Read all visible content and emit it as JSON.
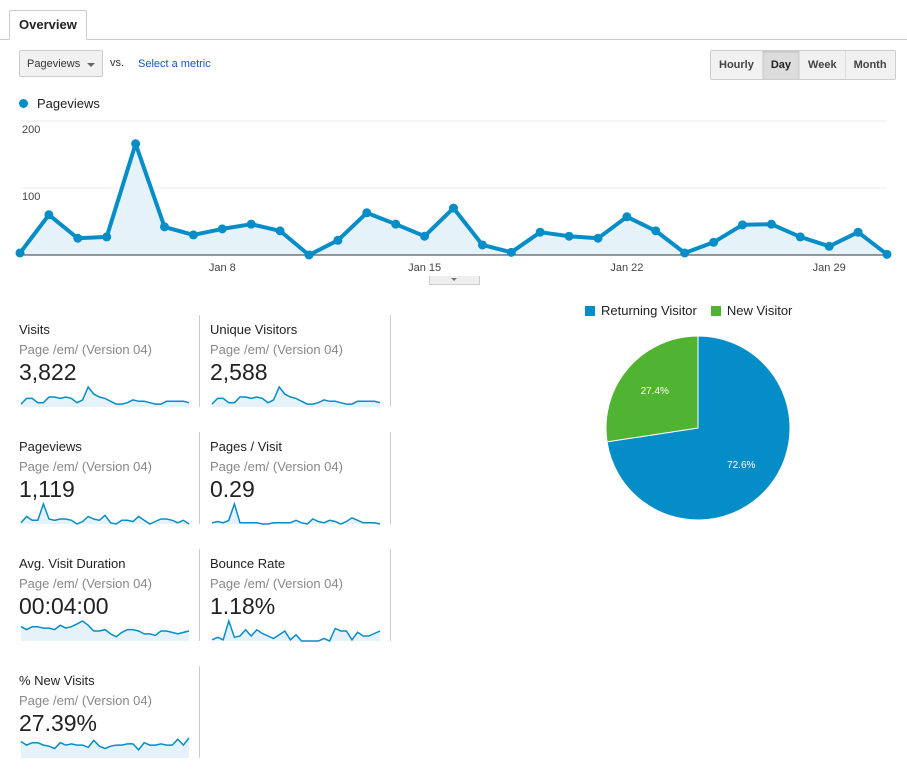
{
  "tabs": [
    {
      "label": "Overview",
      "active": true
    }
  ],
  "toolbar": {
    "metric_select": "Pageviews",
    "vs_label": "vs.",
    "select_metric_link": "Select a metric",
    "periods": [
      {
        "label": "Hourly",
        "active": false
      },
      {
        "label": "Day",
        "active": true
      },
      {
        "label": "Week",
        "active": false
      },
      {
        "label": "Month",
        "active": false
      }
    ]
  },
  "colors": {
    "primary": "#058dc7",
    "secondary": "#50b432",
    "area_fill": "#e6f2fa"
  },
  "chart_data": [
    {
      "type": "area",
      "title": "",
      "legend": [
        "Pageviews"
      ],
      "series": [
        {
          "name": "Pageviews",
          "values": [
            3,
            60,
            25,
            27,
            166,
            42,
            30,
            39,
            46,
            36,
            0,
            22,
            63,
            46,
            28,
            70,
            15,
            4,
            34,
            28,
            25,
            57,
            36,
            3,
            19,
            45,
            46,
            27,
            13,
            34,
            1
          ]
        }
      ],
      "x": [
        "Jan 1",
        "Jan 2",
        "Jan 3",
        "Jan 4",
        "Jan 5",
        "Jan 6",
        "Jan 7",
        "Jan 8",
        "Jan 9",
        "Jan 10",
        "Jan 11",
        "Jan 12",
        "Jan 13",
        "Jan 14",
        "Jan 15",
        "Jan 16",
        "Jan 17",
        "Jan 18",
        "Jan 19",
        "Jan 20",
        "Jan 21",
        "Jan 22",
        "Jan 23",
        "Jan 24",
        "Jan 25",
        "Jan 26",
        "Jan 27",
        "Jan 28",
        "Jan 29",
        "Jan 30",
        "Jan 31"
      ],
      "x_tick_labels": [
        {
          "index": 7,
          "label": "Jan 8"
        },
        {
          "index": 14,
          "label": "Jan 15"
        },
        {
          "index": 21,
          "label": "Jan 22"
        },
        {
          "index": 28,
          "label": "Jan 29"
        }
      ],
      "y_ticks": [
        100,
        200
      ],
      "ylim": [
        0,
        200
      ],
      "grid": true,
      "xlabel": "",
      "ylabel": ""
    },
    {
      "type": "pie",
      "legend_position": "top",
      "slices": [
        {
          "label": "Returning Visitor",
          "value": 72.6,
          "display": "72.6%"
        },
        {
          "label": "New Visitor",
          "value": 27.4,
          "display": "27.4%"
        }
      ]
    }
  ],
  "scorecards": [
    {
      "title": "Visits",
      "subtitle": "Page /em/ (Version 04)",
      "value": "3,822",
      "spark": [
        2,
        6,
        6,
        3,
        3,
        7,
        7,
        6,
        7,
        6,
        3,
        5,
        14,
        9,
        7,
        6,
        4,
        2,
        2,
        3,
        5,
        4,
        4,
        3,
        2,
        2,
        4,
        4,
        4,
        4,
        3
      ]
    },
    {
      "title": "Unique Visitors",
      "subtitle": "Page /em/ (Version 04)",
      "value": "2,588",
      "spark": [
        2,
        6,
        6,
        3,
        3,
        7,
        7,
        6,
        7,
        6,
        3,
        5,
        14,
        9,
        7,
        6,
        4,
        2,
        2,
        3,
        5,
        4,
        4,
        3,
        2,
        2,
        4,
        4,
        4,
        4,
        3
      ]
    },
    {
      "title": "Pageviews",
      "subtitle": "Page /em/ (Version 04)",
      "value": "1,119",
      "spark": [
        1,
        6,
        3,
        3,
        16,
        4,
        3,
        4,
        4,
        3,
        0,
        2,
        6,
        4,
        3,
        7,
        1,
        0,
        3,
        3,
        2,
        6,
        3,
        0,
        2,
        4,
        4,
        3,
        1,
        3,
        0
      ]
    },
    {
      "title": "Pages / Visit",
      "subtitle": "Page /em/ (Version 04)",
      "value": "0.29",
      "spark": [
        1,
        2,
        1,
        3,
        16,
        1,
        1,
        1,
        1,
        0,
        0,
        1,
        1,
        1,
        1,
        3,
        1,
        0,
        4,
        2,
        1,
        3,
        2,
        0,
        2,
        5,
        3,
        1,
        1,
        1,
        0
      ]
    },
    {
      "title": "Avg. Visit Duration",
      "subtitle": "Page /em/ (Version 04)",
      "value": "00:04:00",
      "spark": [
        10,
        8,
        10,
        10,
        9,
        9,
        8,
        11,
        9,
        10,
        12,
        14,
        11,
        7,
        7,
        8,
        5,
        3,
        6,
        8,
        8,
        7,
        5,
        5,
        4,
        7,
        7,
        6,
        5,
        6,
        7
      ]
    },
    {
      "title": "Bounce Rate",
      "subtitle": "Page /em/ (Version 04)",
      "value": "1.18%",
      "spark": [
        1,
        3,
        1,
        16,
        3,
        4,
        9,
        4,
        9,
        6,
        4,
        2,
        5,
        8,
        1,
        5,
        0,
        0,
        0,
        0,
        2,
        0,
        10,
        8,
        8,
        1,
        7,
        4,
        4,
        6,
        8
      ]
    },
    {
      "title": "% New Visits",
      "subtitle": "Page /em/ (Version 04)",
      "value": "27.39%",
      "spark": [
        14,
        11,
        13,
        13,
        11,
        10,
        8,
        13,
        11,
        12,
        11,
        11,
        9,
        15,
        10,
        8,
        10,
        11,
        11,
        12,
        12,
        7,
        13,
        11,
        11,
        12,
        11,
        11,
        16,
        11,
        17
      ]
    }
  ]
}
